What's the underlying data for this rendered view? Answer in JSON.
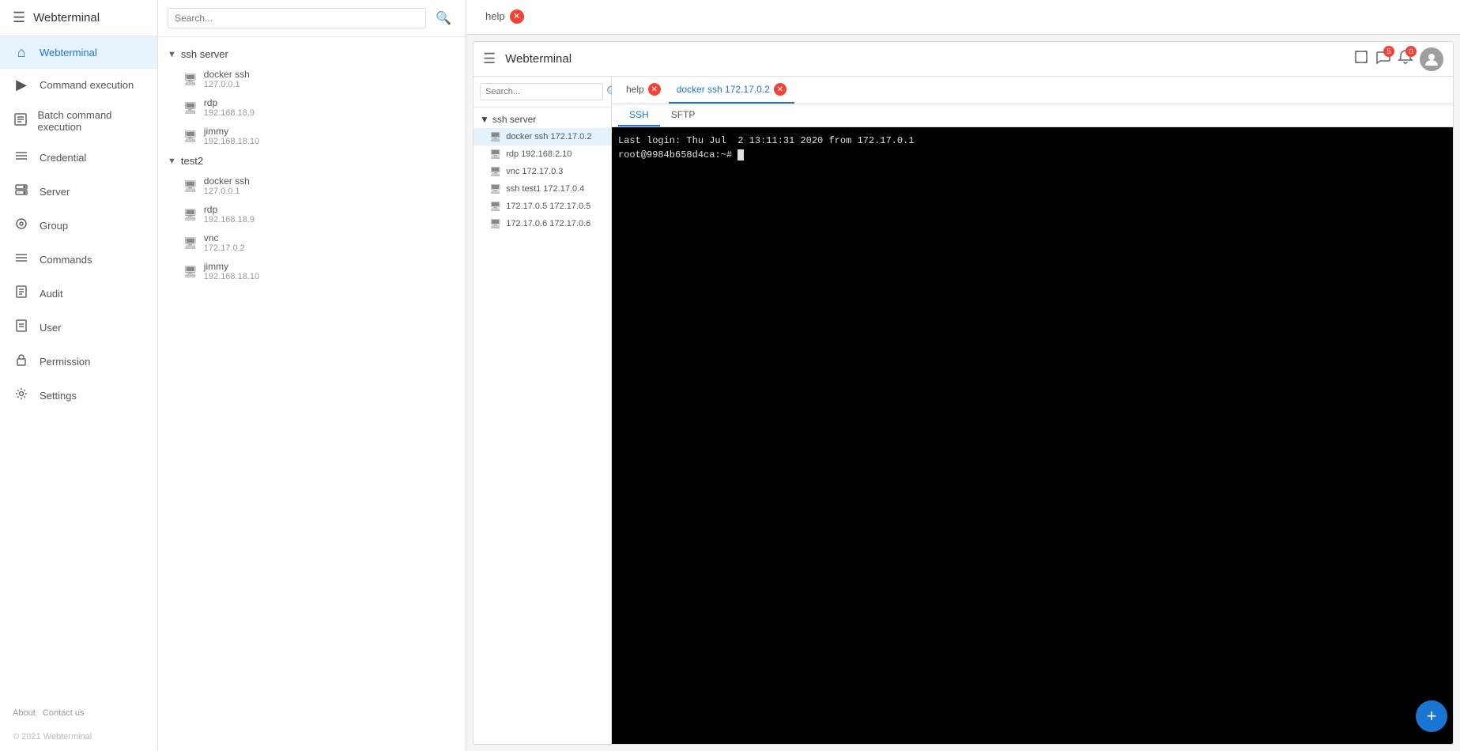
{
  "app": {
    "title": "Webterminal",
    "menu_icon": "☰"
  },
  "nav": {
    "items": [
      {
        "id": "home",
        "label": "Webterminal",
        "icon": "⌂",
        "active": true
      },
      {
        "id": "command-execution",
        "label": "Command execution",
        "icon": "▶"
      },
      {
        "id": "batch-command",
        "label": "Batch command execution",
        "icon": "▤"
      },
      {
        "id": "credential",
        "label": "Credential",
        "icon": "☰"
      },
      {
        "id": "server",
        "label": "Server",
        "icon": "▣"
      },
      {
        "id": "group",
        "label": "Group",
        "icon": "⊙"
      },
      {
        "id": "commands",
        "label": "Commands",
        "icon": "☰"
      },
      {
        "id": "audit",
        "label": "Audit",
        "icon": "☐"
      },
      {
        "id": "user",
        "label": "User",
        "icon": "☐"
      },
      {
        "id": "permission",
        "label": "Permission",
        "icon": "🔒"
      },
      {
        "id": "settings",
        "label": "Settings",
        "icon": "⚙"
      }
    ],
    "footer": {
      "about": "About",
      "contact": "Contact us"
    },
    "copyright": "© 2021 Webterminal"
  },
  "middle": {
    "search_placeholder": "Search...",
    "groups": [
      {
        "name": "ssh server",
        "expanded": true,
        "servers": [
          {
            "name": "docker ssh",
            "ip": "127.0.0.1",
            "type": "ssh"
          },
          {
            "name": "rdp",
            "ip": "192.168.18.9",
            "type": "rdp"
          },
          {
            "name": "jimmy",
            "ip": "192.168.18.10",
            "type": "ssh"
          }
        ]
      },
      {
        "name": "test2",
        "expanded": true,
        "servers": [
          {
            "name": "docker ssh",
            "ip": "127.0.0.1",
            "type": "ssh"
          },
          {
            "name": "rdp",
            "ip": "192.168.18.9",
            "type": "rdp"
          },
          {
            "name": "vnc",
            "ip": "172.17.0.2",
            "type": "vnc"
          },
          {
            "name": "jimmy",
            "ip": "192.168.18.10",
            "type": "ssh"
          }
        ]
      }
    ]
  },
  "top_tabs": [
    {
      "id": "help",
      "label": "help",
      "closable": true,
      "active": false
    }
  ],
  "terminal": {
    "title": "Webterminal",
    "inner_search_placeholder": "Search...",
    "inner_tabs": [
      {
        "id": "help",
        "label": "help",
        "closable": true
      },
      {
        "id": "docker-ssh",
        "label": "docker ssh 172.17.0.2",
        "closable": true,
        "active": true
      }
    ],
    "ssh_sftp_tabs": [
      {
        "id": "ssh",
        "label": "SSH",
        "active": true
      },
      {
        "id": "sftp",
        "label": "SFTP"
      }
    ],
    "inner_groups": [
      {
        "name": "ssh server",
        "servers": [
          {
            "name": "docker ssh 172.17.0.2",
            "active": true
          },
          {
            "name": "rdp 192.168.2.10"
          },
          {
            "name": "vnc 172.17.0.3"
          },
          {
            "name": "ssh test1 172.17.0.4"
          },
          {
            "name": "172.17.0.5 172.17.0.5"
          },
          {
            "name": "172.17.0.6 172.17.0.6"
          }
        ]
      }
    ],
    "terminal_lines": [
      "Last login: Thu Jul  2 13:11:31 2020 from 172.17.0.1",
      "root@9984b658d4ca:~# "
    ],
    "fab_label": "+"
  },
  "header_icons": {
    "expand": "⛶",
    "chat": "💬",
    "bell": "🔔",
    "bell_badge": "0",
    "chat_badge": "5",
    "avatar": "👤"
  }
}
